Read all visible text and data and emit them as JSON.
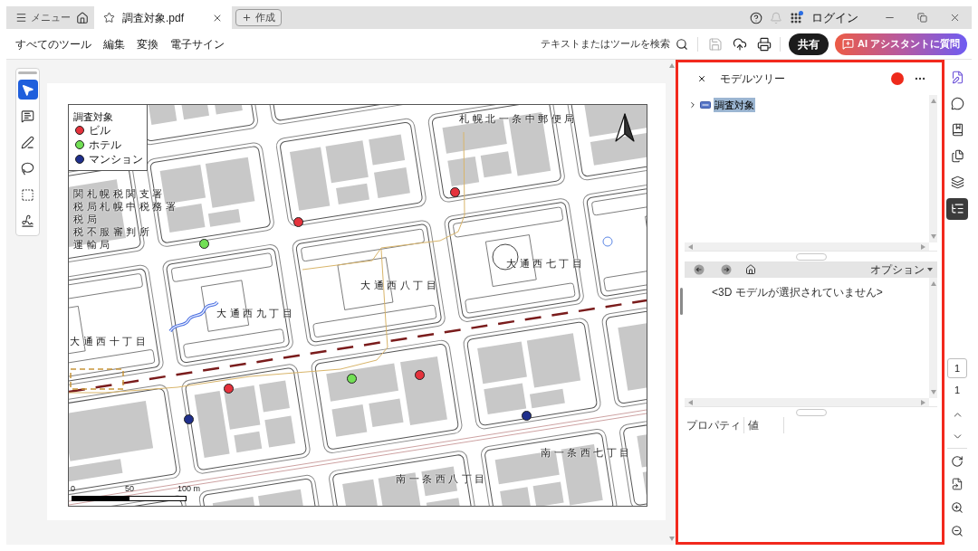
{
  "title_bar": {
    "menu_label": "メニュー",
    "tabs": [
      {
        "title": "調査対象.pdf",
        "selected": true
      }
    ],
    "create_button": "作成",
    "login_button": "ログイン"
  },
  "toolbar": {
    "menu_items": [
      "すべてのツール",
      "編集",
      "変換",
      "電子サイン"
    ],
    "search_label": "テキストまたはツールを検索",
    "actions": [
      {
        "kind": "save",
        "disabled": true
      },
      {
        "kind": "upload",
        "disabled": false
      },
      {
        "kind": "print",
        "disabled": false
      }
    ],
    "share_button": "共有",
    "ai_button": "AI アシスタントに質問"
  },
  "tool_rail": [
    {
      "kind": "select",
      "selected": true
    },
    {
      "kind": "comment",
      "selected": false
    },
    {
      "kind": "draw",
      "selected": false
    },
    {
      "kind": "lasso",
      "selected": false
    },
    {
      "kind": "text_box",
      "selected": false
    },
    {
      "kind": "sign",
      "selected": false
    }
  ],
  "document": {
    "map": {
      "legend": {
        "title": "調査対象",
        "items": [
          {
            "label": "ビル",
            "color": "#e5323c"
          },
          {
            "label": "ホテル",
            "color": "#72e055"
          },
          {
            "label": "マンション",
            "color": "#1f2f8c"
          }
        ]
      },
      "labels": [
        "札幌北一条中郵便局",
        "関札幌税関支署",
        "税局札幌中税務署",
        "税局",
        "税不服審判所",
        "運輸局",
        "大通西七丁目",
        "大通西八丁目",
        "大通西九丁目",
        "大通西十丁目",
        "南一条西七丁目",
        "南一条西八丁目"
      ],
      "markers": [
        {
          "color": "#e5323c"
        },
        {
          "color": "#e5323c"
        },
        {
          "color": "#72e055"
        },
        {
          "color": "#e5323c"
        },
        {
          "color": "#72e055"
        },
        {
          "color": "#e5323c"
        },
        {
          "color": "#1f2f8c"
        },
        {
          "color": "#1f2f8c"
        }
      ],
      "scale_labels": [
        "0",
        "50",
        "100 m"
      ]
    }
  },
  "model_tree_panel": {
    "title": "モデルツリー",
    "tree": [
      {
        "label": "調査対象",
        "expanded": false,
        "selected": true
      }
    ],
    "options_label": "オプション",
    "message": "<3D モデルが選択されていません>",
    "property_columns": [
      "プロパティ",
      "値"
    ]
  },
  "side_rail": {
    "tools": [
      {
        "kind": "ai_edit",
        "selected": false
      },
      {
        "kind": "comments",
        "selected": false
      },
      {
        "kind": "bookmarks",
        "selected": false
      },
      {
        "kind": "pages",
        "selected": false
      },
      {
        "kind": "layers",
        "selected": false
      },
      {
        "kind": "model_tree",
        "selected": true
      }
    ],
    "page_number": "1",
    "page_count": "1"
  }
}
